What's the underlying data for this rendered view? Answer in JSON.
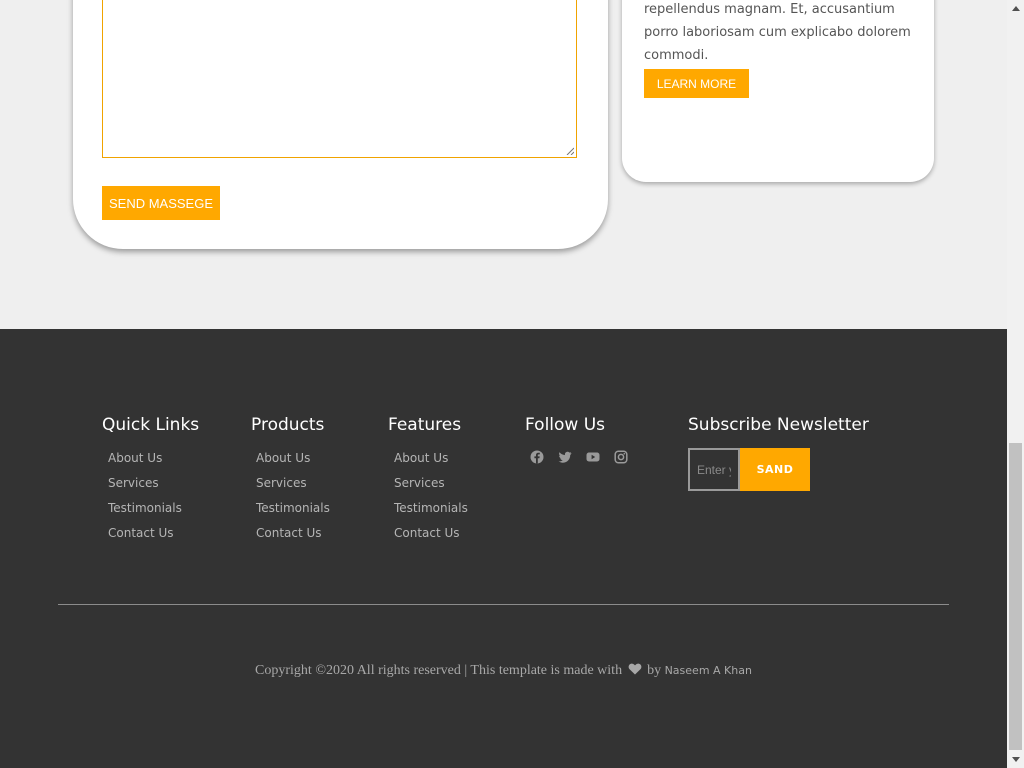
{
  "contact": {
    "send_label": "SEND MASSEGE"
  },
  "info": {
    "text": "repellendus magnam. Et, accusantium porro laboriosam cum explicabo dolorem commodi.",
    "learn_more_label": "LEARN MORE"
  },
  "footer": {
    "columns": [
      {
        "title": "Quick Links",
        "links": [
          "About Us",
          "Services",
          "Testimonials",
          "Contact Us"
        ]
      },
      {
        "title": "Products",
        "links": [
          "About Us",
          "Services",
          "Testimonials",
          "Contact Us"
        ]
      },
      {
        "title": "Features",
        "links": [
          "About Us",
          "Services",
          "Testimonials",
          "Contact Us"
        ]
      }
    ],
    "follow": {
      "title": "Follow Us",
      "icons": [
        "facebook-icon",
        "twitter-icon",
        "youtube-icon",
        "instagram-icon"
      ]
    },
    "newsletter": {
      "title": "Subscribe Newsletter",
      "placeholder": "Enter your email",
      "button_label": "SAND"
    },
    "copyright": {
      "prefix": "Copyright ©2020 All rights reserved | This template is made with",
      "by": "by",
      "author": "Naseem A Khan"
    }
  },
  "colors": {
    "accent": "#ffa800",
    "footer_bg": "#333333",
    "page_bg": "#efefef"
  }
}
